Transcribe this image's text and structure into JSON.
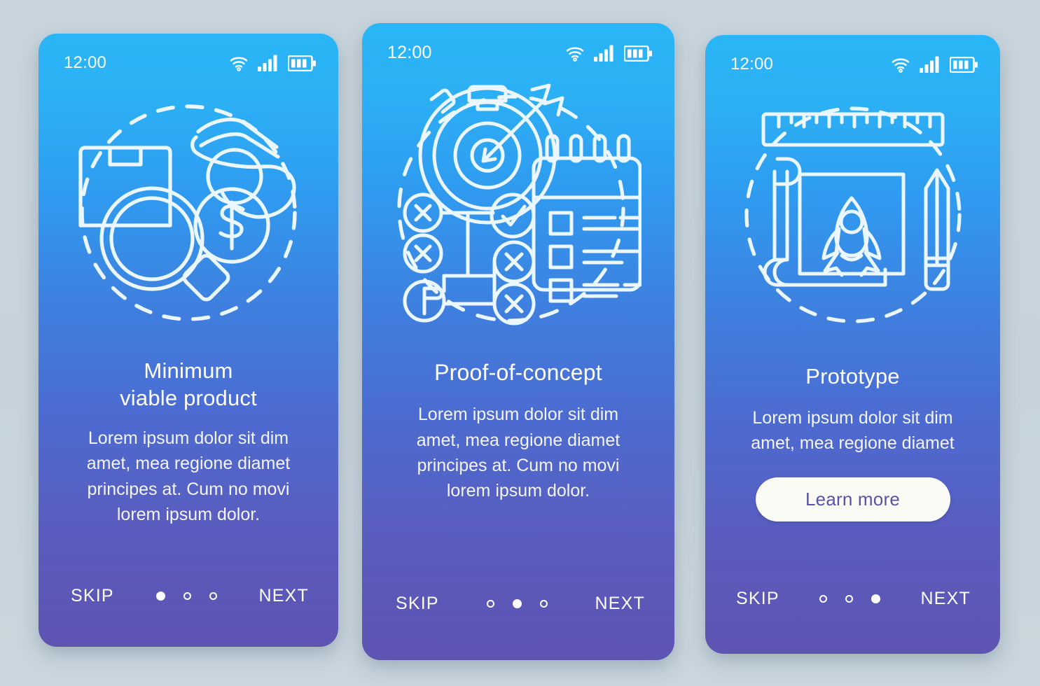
{
  "background_color": "#c7d4dc",
  "screens": [
    {
      "id": "minimum-viable-product",
      "status": {
        "time": "12:00",
        "wifi": "wifi-icon",
        "signal": "signal-bars-icon",
        "battery": "battery-icon"
      },
      "illustration": "box-magnifier-money-hand-illustration",
      "title": "Minimum\nviable product",
      "body": "Lorem ipsum dolor sit dim\namet, mea regione diamet\nprincipes at. Cum no movi\nlorem ipsum dolor.",
      "cta": null,
      "nav": {
        "skip_label": "SKIP",
        "next_label": "NEXT",
        "dots": 3,
        "active_dot": 1
      }
    },
    {
      "id": "proof-of-concept",
      "status": {
        "time": "12:00",
        "wifi": "wifi-icon",
        "signal": "signal-bars-icon",
        "battery": "battery-icon"
      },
      "illustration": "stopwatch-target-flowchart-notepad-illustration",
      "title": "Proof-of-concept",
      "body": "Lorem ipsum dolor sit dim\namet, mea regione diamet\nprincipes at. Cum no movi\nlorem ipsum dolor.",
      "cta": null,
      "nav": {
        "skip_label": "SKIP",
        "next_label": "NEXT",
        "dots": 3,
        "active_dot": 2
      }
    },
    {
      "id": "prototype",
      "status": {
        "time": "12:00",
        "wifi": "wifi-icon",
        "signal": "signal-bars-icon",
        "battery": "battery-icon"
      },
      "illustration": "ruler-blueprint-rocket-pencil-illustration",
      "title": "Prototype",
      "body": "Lorem ipsum dolor sit dim\namet, mea regione diamet",
      "cta": "Learn more",
      "nav": {
        "skip_label": "SKIP",
        "next_label": "NEXT",
        "dots": 3,
        "active_dot": 3
      }
    }
  ],
  "colors": {
    "gradient_top": "#29b6f6",
    "gradient_bottom": "#5e54b2",
    "cta_background": "#fbfbf6",
    "cta_text": "#5a52a6",
    "text": "#ffffff"
  }
}
